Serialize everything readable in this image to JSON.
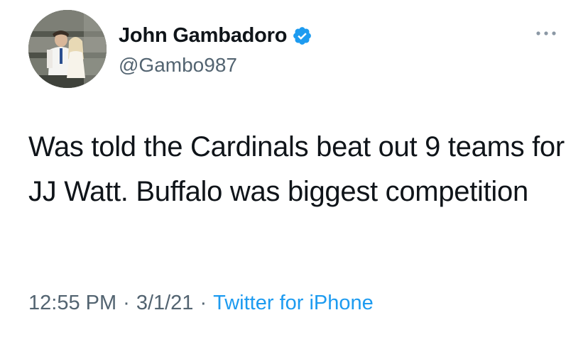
{
  "tweet": {
    "author": {
      "display_name": "John Gambadoro",
      "handle": "@Gambo987",
      "verified": true,
      "avatar_icon": "profile-photo"
    },
    "more_icon": "more-horizontal-icon",
    "text": "Was told the Cardinals beat out 9 teams for JJ Watt. Buffalo was biggest competition",
    "time": "12:55 PM",
    "date": "3/1/21",
    "separator": "·",
    "source": "Twitter for iPhone"
  },
  "colors": {
    "text_primary": "#0f1419",
    "text_secondary": "#536471",
    "accent": "#1d9bf0"
  }
}
